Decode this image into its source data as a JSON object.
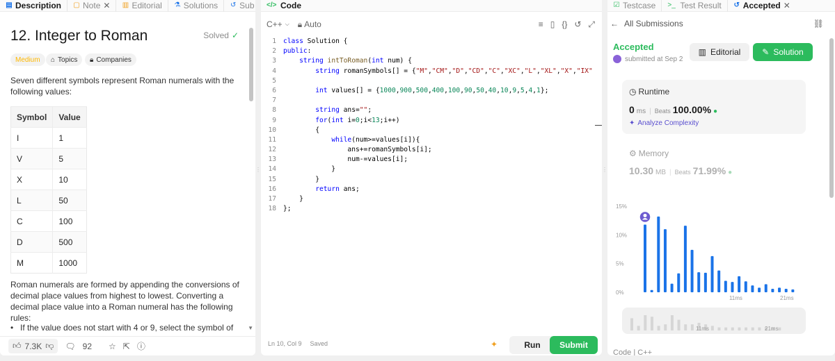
{
  "left": {
    "tabs": [
      {
        "label": "Description",
        "icon": "document-icon"
      },
      {
        "label": "Note",
        "icon": "note-icon",
        "closable": true
      },
      {
        "label": "Editorial",
        "icon": "book-icon"
      },
      {
        "label": "Solutions",
        "icon": "flask-icon"
      },
      {
        "label": "Sub",
        "icon": "history-icon"
      }
    ],
    "title": "12. Integer to Roman",
    "solved": "Solved",
    "difficulty": "Medium",
    "topics": "Topics",
    "companies": "Companies",
    "intro": "Seven different symbols represent Roman numerals with the following values:",
    "table": {
      "headers": [
        "Symbol",
        "Value"
      ],
      "rows": [
        [
          "I",
          "1"
        ],
        [
          "V",
          "5"
        ],
        [
          "X",
          "10"
        ],
        [
          "L",
          "50"
        ],
        [
          "C",
          "100"
        ],
        [
          "D",
          "500"
        ],
        [
          "M",
          "1000"
        ]
      ]
    },
    "para": "Roman numerals are formed by appending the conversions of decimal place values from highest to lowest. Converting a decimal place value into a Roman numeral has the following rules:",
    "bullet": "If the value does not start with 4 or 9, select the symbol of",
    "footer": {
      "likes": "7.3K",
      "comments": "92"
    }
  },
  "code": {
    "tab_label": "Code",
    "language": "C++",
    "mode": "Auto",
    "lines": [
      "class Solution {",
      "public:",
      "    string intToRoman(int num) {",
      "        string romanSymbols[] = {\"M\",\"CM\",\"D\",\"CD\",\"C\",\"XC\",\"L\",\"XL\",\"X\",\"IX\",",
      "",
      "        int values[] = {1000,900,500,400,100,90,50,40,10,9,5,4,1};",
      "",
      "        string ans=\"\";",
      "        for(int i=0;i<13;i++)",
      "        {",
      "            while(num>=values[i]){",
      "                ans+=romanSymbols[i];",
      "                num-=values[i];",
      "            }",
      "        }",
      "        return ans;",
      "    }",
      "};"
    ],
    "status": "Ln 10, Col 9",
    "saved": "Saved",
    "run": "Run",
    "submit": "Submit"
  },
  "result": {
    "tabs": [
      {
        "label": "Testcase",
        "icon": "checkbox-icon"
      },
      {
        "label": "Test Result",
        "icon": "terminal-icon"
      },
      {
        "label": "Accepted",
        "icon": "history-icon",
        "closable": true
      }
    ],
    "back": "All Submissions",
    "status": "Accepted",
    "submitted": "submitted at Sep 2",
    "editorial_btn": "Editorial",
    "solution_btn": "Solution",
    "runtime": {
      "label": "Runtime",
      "value": "0",
      "unit": "ms",
      "beats_label": "Beats",
      "beats": "100.00%",
      "analyze": "Analyze Complexity"
    },
    "memory": {
      "label": "Memory",
      "value": "10.30",
      "unit": "MB",
      "beats_label": "Beats",
      "beats": "71.99%"
    },
    "footer": "Code | C++",
    "accent": "#2cbb5d",
    "bar_color": "#1a73e8"
  },
  "chart_data": {
    "type": "bar",
    "ylabel": "",
    "y_ticks": [
      "15%",
      "10%",
      "5%",
      "0%"
    ],
    "x_ticks": [
      "11ms",
      "21ms"
    ],
    "ylim": [
      0,
      15
    ],
    "values": [
      11.8,
      0.4,
      13.2,
      11.0,
      1.5,
      3.3,
      11.6,
      7.4,
      3.5,
      3.4,
      6.3,
      3.8,
      2.0,
      1.8,
      2.8,
      1.9,
      1.2,
      0.8,
      1.4,
      0.6,
      0.8,
      0.6,
      0.5
    ],
    "mini_values": [
      0.8,
      0.3,
      1.0,
      0.9,
      0.3,
      0.4,
      1.0,
      0.7,
      0.4,
      0.4,
      0.5,
      0.4,
      0.3,
      0.2,
      0.2,
      0.2,
      0.2,
      0.2,
      0.2,
      0.2,
      0.2,
      0.2,
      0.2
    ],
    "mini_ticks": [
      "11ms",
      "21ms"
    ]
  }
}
